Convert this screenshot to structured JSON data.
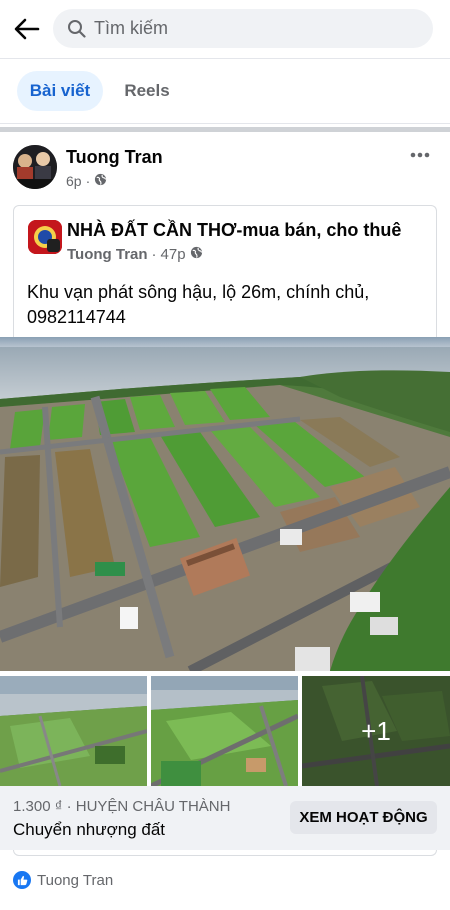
{
  "search": {
    "placeholder": "Tìm kiếm"
  },
  "tabs": [
    {
      "label": "Bài viết",
      "active": true
    },
    {
      "label": "Reels",
      "active": false
    }
  ],
  "post": {
    "author": "Tuong Tran",
    "time": "6p",
    "privacy_icon": "globe-icon",
    "shared": {
      "group_name": "NHÀ ĐẤT CẦN THƠ-mua bán, cho thuê",
      "author": "Tuong Tran",
      "time": "47p",
      "text": "Khu vạn phát sông hậu, lộ 26m, chính chủ, 0982114744"
    },
    "photos": {
      "more_count": "+1"
    },
    "listing": {
      "price_location": "1.300 ₫ · HUYỆN CHÂU THÀNH",
      "title": "Chuyển nhượng đất",
      "action_label": "XEM HOẠT ĐỘNG"
    },
    "reactions": {
      "icon": "like-icon",
      "name": "Tuong Tran"
    }
  },
  "colors": {
    "accent": "#1877f2",
    "active_tab_bg": "#e7f3ff",
    "active_tab_text": "#1763cf",
    "secondary_text": "#65676b",
    "listing_bg": "#f0f2f5"
  }
}
